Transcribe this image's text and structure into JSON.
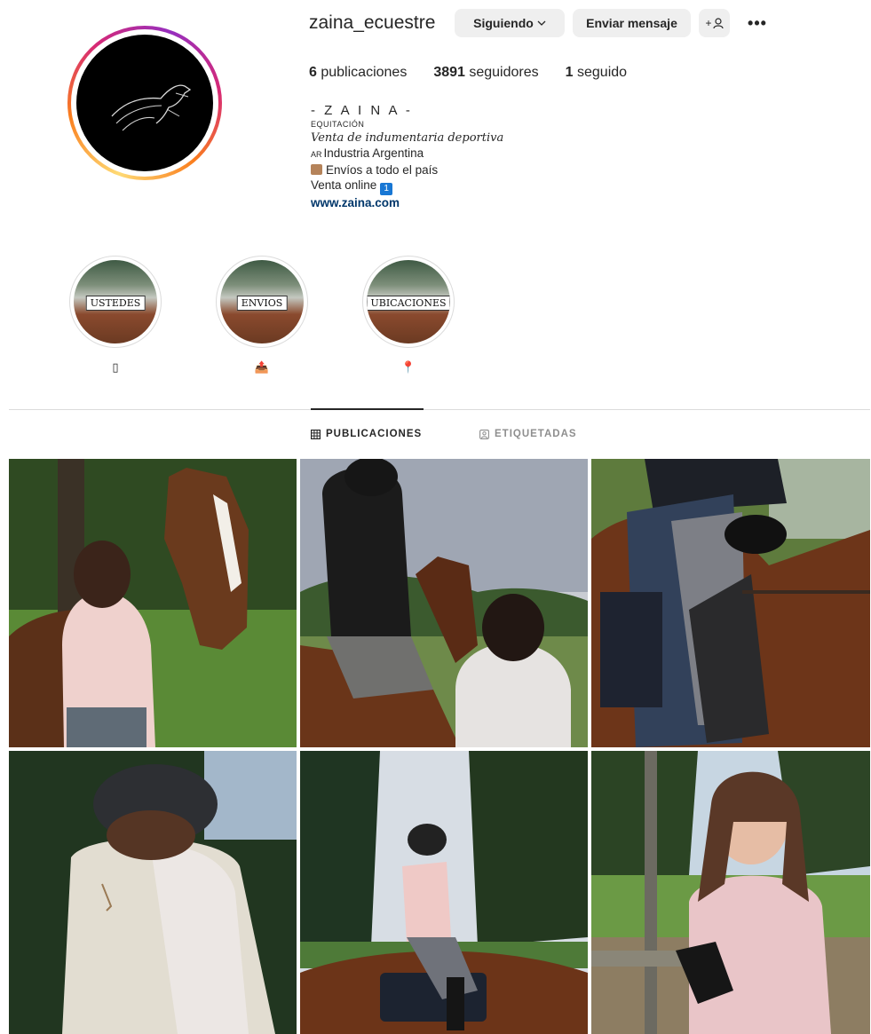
{
  "profile": {
    "username": "zaina_ecuestre",
    "follow_label": "Siguiendo",
    "message_label": "Enviar mensaje",
    "add_label": "+",
    "more_label": "•••"
  },
  "stats": {
    "posts_count": "6",
    "posts_label": "publicaciones",
    "followers_count": "3891",
    "followers_label": "seguidores",
    "following_count": "1",
    "following_label": "seguido"
  },
  "bio": {
    "name": "- Z A I N A -",
    "category": "EQUITACIÓN",
    "line1": "Venta de indumentaria deportiva",
    "flag_code": "AR",
    "line2": "Industria Argentina",
    "line3": "Envíos a todo el país",
    "line4": "Venta online",
    "badge": "1",
    "link": "www.zaina.com"
  },
  "highlights": [
    {
      "label": "USTEDES",
      "emoji": "▯"
    },
    {
      "label": "ENVIOS",
      "emoji": "📤"
    },
    {
      "label": "UBICACIONES",
      "emoji": "📍"
    }
  ],
  "tabs": {
    "posts": "PUBLICACIONES",
    "tagged": "ETIQUETADAS"
  },
  "icons": {
    "grid": "grid-icon",
    "tag": "tag-person-icon",
    "chevron": "chevron-down-icon",
    "add_person": "add-person-icon",
    "more": "more-options-icon"
  },
  "colors": {
    "link": "#00376b",
    "button_bg": "#efefef",
    "muted": "#8e8e8e"
  }
}
